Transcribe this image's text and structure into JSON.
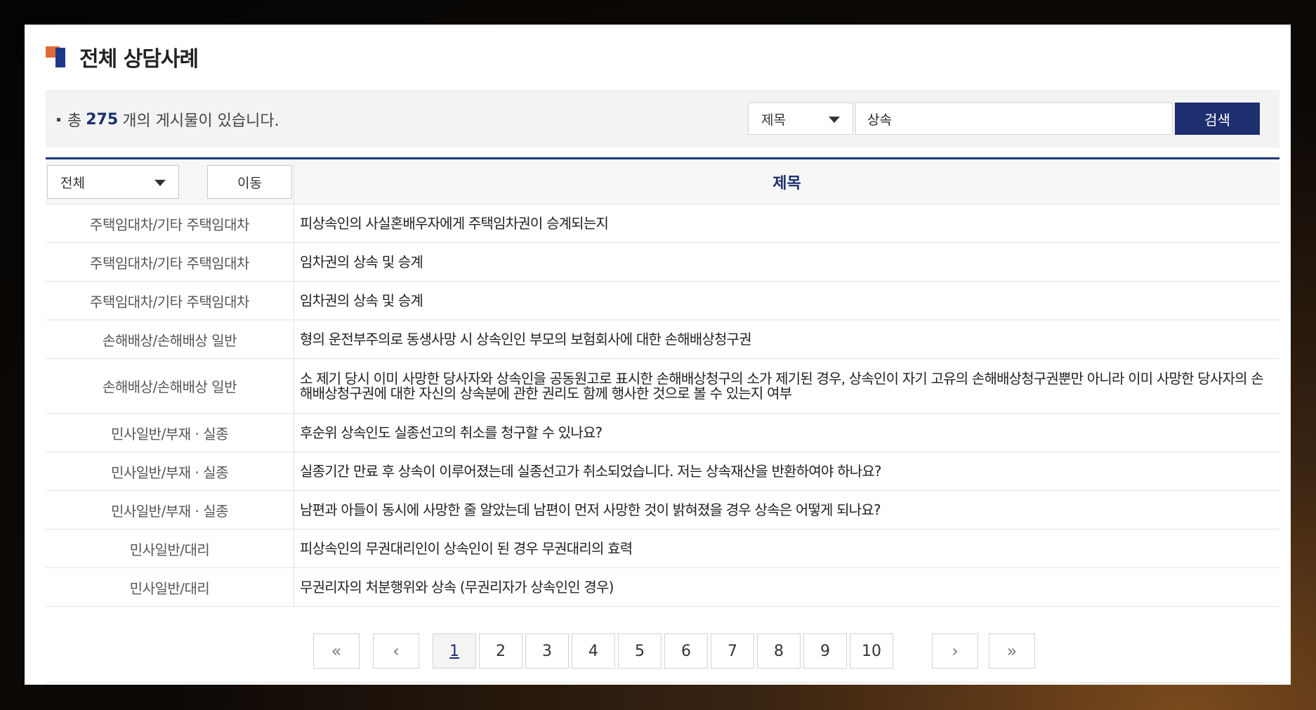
{
  "page": {
    "title": "전체 상담사례"
  },
  "summary": {
    "prefix": "총",
    "count": "275",
    "suffix": "개의 게시물이 있습니다."
  },
  "search": {
    "field_selected": "제목",
    "query": "상속",
    "button_label": "검색"
  },
  "filter": {
    "category_selected": "전체",
    "move_button_label": "이동",
    "title_header": "제목"
  },
  "rows": [
    {
      "category": "주택임대차/기타 주택임대차",
      "title": "피상속인의 사실혼배우자에게 주택임차권이 승계되는지"
    },
    {
      "category": "주택임대차/기타 주택임대차",
      "title": "임차권의 상속 및 승계"
    },
    {
      "category": "주택임대차/기타 주택임대차",
      "title": "임차권의 상속 및 승계"
    },
    {
      "category": "손해배상/손해배상 일반",
      "title": "형의 운전부주의로 동생사망 시 상속인인 부모의 보험회사에 대한 손해배상청구권"
    },
    {
      "category": "손해배상/손해배상 일반",
      "title": "소 제기 당시 이미 사망한 당사자와 상속인을 공동원고로 표시한 손해배상청구의 소가 제기된 경우, 상속인이 자기 고유의 손해배상청구권뿐만 아니라 이미 사망한 당사자의 손해배상청구권에 대한 자신의 상속분에 관한 권리도 함께 행사한 것으로 볼 수 있는지 여부"
    },
    {
      "category": "민사일반/부재 · 실종",
      "title": "후순위 상속인도 실종선고의 취소를 청구할 수 있나요?"
    },
    {
      "category": "민사일반/부재 · 실종",
      "title": "실종기간 만료 후 상속이 이루어졌는데 실종선고가 취소되었습니다. 저는 상속재산을 반환하여야 하나요?"
    },
    {
      "category": "민사일반/부재 · 실종",
      "title": "남편과 아들이 동시에 사망한 줄 알았는데 남편이 먼저 사망한 것이 밝혀졌을 경우 상속은 어떻게 되나요?"
    },
    {
      "category": "민사일반/대리",
      "title": "피상속인의 무권대리인이 상속인이 된 경우 무권대리의 효력"
    },
    {
      "category": "민사일반/대리",
      "title": "무권리자의 처분행위와 상속 (무권리자가 상속인인 경우)"
    }
  ],
  "pagination": {
    "first": "«",
    "prev": "‹",
    "pages": [
      "1",
      "2",
      "3",
      "4",
      "5",
      "6",
      "7",
      "8",
      "9",
      "10"
    ],
    "current": "1",
    "next": "›",
    "last": "»"
  }
}
